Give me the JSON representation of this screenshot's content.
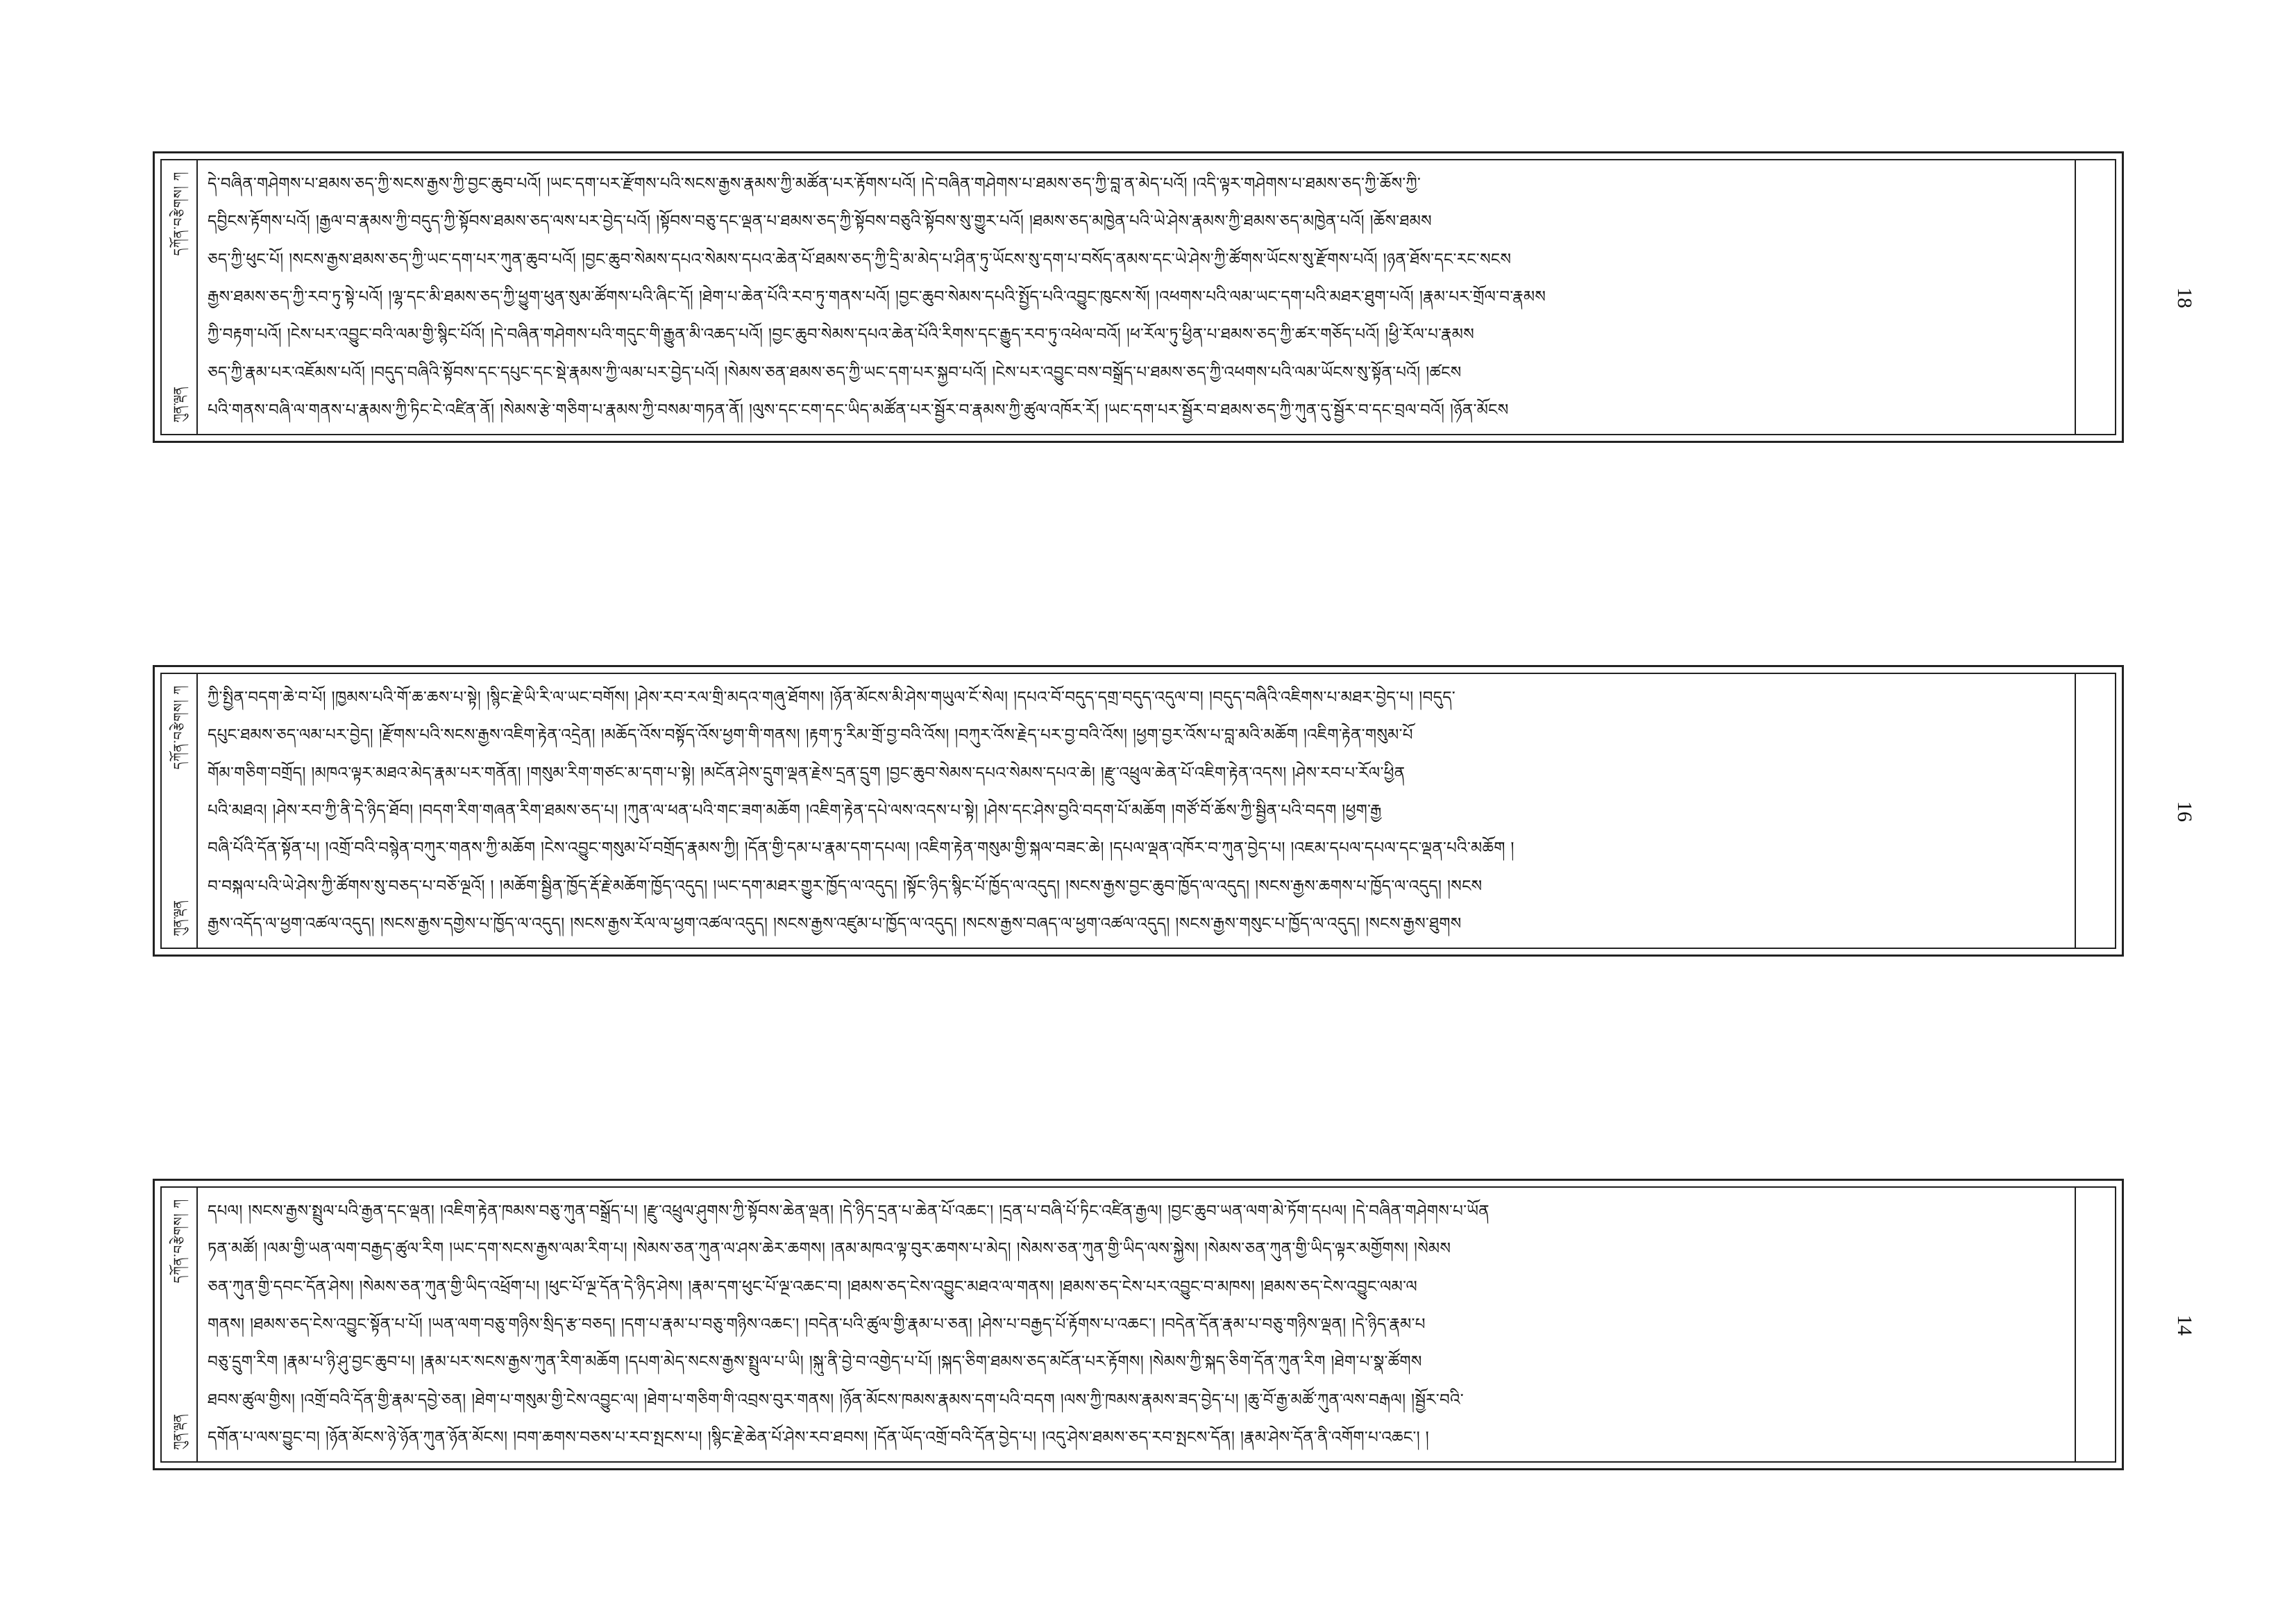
{
  "folios": [
    {
      "margin_title": "དཀོན་བརྩེགས། ཀ",
      "margin_mark": "ཀུན་ལྡན",
      "page_number": "18",
      "lines": [
        "དེ་བཞིན་གཤེགས་པ་ཐམས་ཅད་ཀྱི་སངས་རྒྱས་ཀྱི་བྱང་ཆུབ་པའོ། །ཡང་དག་པར་རྫོགས་པའི་སངས་རྒྱས་རྣམས་ཀྱི་མཚོན་པར་རྟོགས་པའོ། །དེ་བཞིན་གཤེགས་པ་ཐམས་ཅད་ཀྱི་བླ་ན་མེད་པའོ། །འདི་ལྟར་གཤེགས་པ་ཐམས་ཅད་ཀྱི་ཆོས་ཀྱི་",
        "དབྱིངས་རྟོགས་པའོ། །རྒྱལ་བ་རྣམས་ཀྱི་བདུད་ཀྱི་སྟོབས་ཐམས་ཅད་ལས་པར་བྱེད་པའོ། །སྟོབས་བཅུ་དང་ལྡན་པ་ཐམས་ཅད་ཀྱི་སྟོབས་བཅུའི་སྟོབས་སུ་གྱུར་པའོ། །ཐམས་ཅད་མཁྱེན་པའི་ཡེ་ཤེས་རྣམས་ཀྱི་ཐམས་ཅད་མཁྱེན་པའོ། །ཆོས་ཐམས",
        "ཅད་ཀྱི་ཕུང་པོ། །སངས་རྒྱས་ཐམས་ཅད་ཀྱི་ཡང་དག་པར་ཀུན་ཆུབ་པའོ། །བྱང་ཆུབ་སེམས་དཔའ་སེམས་དཔའ་ཆེན་པོ་ཐམས་ཅད་ཀྱི་དྲི་མ་མེད་པ་ཤིན་ཏུ་ཡོངས་སུ་དག་པ་བསོད་ནམས་དང་ཡེ་ཤེས་ཀྱི་ཚོགས་ཡོངས་སུ་རྫོགས་པའོ། །ཉན་ཐོས་དང་རང་སངས",
        "རྒྱས་ཐམས་ཅད་ཀྱི་རབ་ཏུ་སྟེ་པའོ། །ལྷ་དང་མི་ཐམས་ཅད་ཀྱི་ཕྱུག་ཕུན་སུམ་ཚོགས་པའི་ཞིང་དོ། །ཐེག་པ་ཆེན་པོའི་རབ་ཏུ་གནས་པའོ། །བྱང་ཆུབ་སེམས་དཔའི་སྤྱོད་པའི་འབྱུང་ཁུངས་སོ། །འཕགས་པའི་ལམ་ཡང་དག་པའི་མཐར་ཐུག་པའོ། །རྣམ་པར་གྲོལ་བ་རྣམས",
        "ཀྱི་བརྟག་པའོ། །ངེས་པར་འབྱུང་བའི་ལམ་གྱི་སྙིང་པོའོ། །དེ་བཞིན་གཤེགས་པའི་གདུང་གི་རྒྱུན་མི་འཆད་པའོ། །བྱང་ཆུབ་སེམས་དཔའ་ཆེན་པོའི་རིགས་དང་རྒྱུད་རབ་ཏུ་འཕེལ་བའོ། །ཕ་རོལ་ཏུ་ཕྱིན་པ་ཐམས་ཅད་ཀྱི་ཚར་གཅོད་པའོ། །ཕྱི་རོལ་པ་རྣམས",
        "ཅད་ཀྱི་རྣམ་པར་འཇོམས་པའོ། །བདུད་བཞིའི་སྟོབས་དང་དཔུང་དང་སྡེ་རྣམས་ཀྱི་ལམ་པར་བྱེད་པའོ། །སེམས་ཅན་ཐམས་ཅད་ཀྱི་ཡང་དག་པར་སྐྱབ་པའོ། །ངེས་པར་འབྱུང་བས་བསྒྲོད་པ་ཐམས་ཅད་ཀྱི་འཕགས་པའི་ལམ་ཡོངས་སུ་སྟོན་པའོ། །ཚངས",
        "པའི་གནས་བཞི་ལ་གནས་པ་རྣམས་ཀྱི་ཏིང་ངེ་འཛིན་ནོ། །སེམས་རྩེ་གཅིག་པ་རྣམས་ཀྱི་བསམ་གཏན་ནོ། །ལུས་དང་ངག་དང་ཡིད་མཚོན་པར་སྦྱོར་བ་རྣམས་ཀྱི་ཚུལ་འཁོར་རོ། །ཡང་དག་པར་སྦྱོར་བ་ཐམས་ཅད་ཀྱི་ཀུན་དུ་སྦྱོར་བ་དང་བྲལ་བའོ། །ཉོན་མོངས"
      ]
    },
    {
      "margin_title": "དཀོན་བརྩེགས། ཀ",
      "margin_mark": "ཀུན་ལྡན",
      "page_number": "16",
      "lines": [
        "ཀྱི་སྤྱིན་བདག་ཆེ་བ་པོ། །ཁྱམས་པའི་གོ་ཆ་ཆས་པ་སྟེ། །སྙིང་རྗེ་ཡི་རི་ལ་ཡང་བགོས། །ཤེས་རབ་རལ་གྲི་མདའ་གཞུ་ཐོགས། །ཉོན་མོངས་མི་ཤེས་གཡུལ་ངོ་སེལ། །དཔའ་བོ་བདུད་དགྲ་བདུད་འདུལ་བ། །བདུད་བཞིའི་འཇིགས་པ་མཐར་བྱེད་པ། །བདུད་",
        "དཔུང་ཐམས་ཅད་ལམ་པར་བྱེད། །རྫོགས་པའི་སངས་རྒྱས་འཇིག་རྟེན་འདྲེན། །མཆོད་འོས་བསྟོད་འོས་ཕྱག་གི་གནས། །རྟག་ཏུ་རིམ་གྲོ་བྱ་བའི་འོས། །བཀུར་འོས་རྗེད་པར་བྱ་བའི་འོས། །ཕྱག་བྱར་འོས་པ་བླ་མའི་མཆོག །འཇིག་རྟེན་གསུམ་པོ",
        "གོམ་གཅིག་བགྲོད། །མཁའ་ལྟར་མཐའ་མེད་རྣམ་པར་གནོན། །གསུམ་རིག་གཙང་མ་དག་པ་སྟེ། །མངོན་ཤེས་དྲུག་ལྡན་རྗེས་དྲན་དྲུག །བྱང་ཆུབ་སེམས་དཔའ་སེམས་དཔའ་ཆེ། །རྫུ་འཕྲུལ་ཆེན་པོ་འཇིག་རྟེན་འདས། །ཤེས་རབ་པ་རོལ་ཕྱིན",
        "པའི་མཐའ། །ཤེས་རབ་ཀྱི་ནི་དེ་ཉིད་ཐོབ། །བདག་རིག་གཞན་རིག་ཐམས་ཅད་པ། །ཀུན་ལ་ཕན་པའི་གང་ཟག་མཆོག །འཇིག་རྟེན་དཔེ་ལས་འདས་པ་སྟེ། །ཤེས་དང་ཤེས་བྱའི་བདག་པོ་མཆོག །གཙོ་བོ་ཆོས་ཀྱི་སྦྱིན་པའི་བདག །ཕྱག་རྒྱ",
        "བཞི་པོའི་དོན་སྟོན་པ། །འགྲོ་བའི་བསྙེན་བཀུར་གནས་ཀྱི་མཆོག །ངེས་འབྱུང་གསུམ་པོ་བགྲོད་རྣམས་ཀྱི། །དོན་གྱི་དམ་པ་རྣམ་དག་དཔལ། །འཇིག་རྟེན་གསུམ་གྱི་སྐལ་བཟང་ཆེ། །དཔལ་ལྡན་འཁོར་བ་ཀུན་བྱེད་པ། །འཇམ་དཔལ་དཔལ་དང་ལྡན་པའི་མཆོག །",
        "བ་བསྐལ་པའི་ཡེ་ཤེས་ཀྱི་ཚོགས་སུ་བཅད་པ་བཅོ་ལྔའོ། ། །མཆོག་སྦྱིན་ཁྱོད་རྡོ་རྗེ་མཆོག་ཁྱོད་འདུད། །ཡང་དག་མཐར་གྱུར་ཁྱོད་ལ་འདུད། །སྟོང་ཉིད་སྙིང་པོ་ཁྱོད་ལ་འདུད། །སངས་རྒྱས་བྱང་ཆུབ་ཁྱོད་ལ་འདུད། །སངས་རྒྱས་ཆགས་པ་ཁྱོད་ལ་འདུད། །སངས",
        "རྒྱས་འདོད་ལ་ཕྱག་འཚལ་འདུད། །སངས་རྒྱས་དགྱེས་པ་ཁྱོད་ལ་འདུད། །སངས་རྒྱས་རོལ་ལ་ཕྱག་འཚལ་འདུད། །སངས་རྒྱས་འཛུམ་པ་ཁྱོད་ལ་འདུད། །སངས་རྒྱས་བཞད་ལ་ཕྱག་འཚལ་འདུད། །སངས་རྒྱས་གསུང་པ་ཁྱོད་ལ་འདུད། །སངས་རྒྱས་ཐུགས"
      ]
    },
    {
      "margin_title": "དཀོན་བརྩེགས། ཀ",
      "margin_mark": "ཀུན་ལྡན",
      "page_number": "14",
      "lines": [
        "དཔལ། །སངས་རྒྱས་སྤྲུལ་པའི་རྒྱན་དང་ལྡན། །འཇིག་རྟེན་ཁམས་བཅུ་ཀུན་བསྒྲོད་པ། །རྫུ་འཕྲུལ་ཤུགས་ཀྱི་སྟོབས་ཆེན་ལྡན། །དེ་ཉིད་དྲན་པ་ཆེན་པོ་འཆང་། །དྲན་པ་བཞི་པོ་ཏིང་འཛིན་རྒྱལ། །བྱང་ཆུབ་ཡན་ལག་མེ་ཏོག་དཔལ། །དེ་བཞིན་གཤེགས་པ་ཡོན",
        "ཏན་མཚོ། །ལམ་གྱི་ཡན་ལག་བརྒྱད་ཚུལ་རིག །ཡང་དག་སངས་རྒྱས་ལམ་རིག་པ། །སེམས་ཅན་ཀུན་ལ་ཤས་ཆེར་ཆགས། །ནམ་མཁའ་ལྟ་བུར་ཆགས་པ་མེད། །སེམས་ཅན་ཀུན་གྱི་ཡིད་ལས་སྐྱེས། །སེམས་ཅན་ཀུན་གྱི་ཡིད་ལྟར་མགྱོགས། །སེམས",
        "ཅན་ཀུན་གྱི་དབང་དོན་ཤེས། །སེམས་ཅན་ཀུན་གྱི་ཡིད་འཕྲོག་པ། །ཕུང་པོ་ལྔ་དོན་དེ་ཉིད་ཤེས། །རྣམ་དག་ཕུང་པོ་ལྔ་འཆང་བ། །ཐམས་ཅད་ངེས་འབྱུང་མཐའ་ལ་གནས། །ཐམས་ཅད་ངེས་པར་འབྱུང་བ་མཁས། །ཐམས་ཅད་ངེས་འབྱུང་ལམ་ལ",
        "གནས། །ཐམས་ཅད་ངེས་འབྱུང་སྟོན་པ་པོ། །ཡན་ལག་བཅུ་གཉིས་སྲིད་རྩ་བཅད། །དག་པ་རྣམ་པ་བཅུ་གཉིས་འཆང་། །བདེན་པའི་ཚུལ་གྱི་རྣམ་པ་ཅན། །ཤེས་པ་བརྒྱད་པོ་རྟོགས་པ་འཆང་། །བདེན་དོན་རྣམ་པ་བཅུ་གཉིས་ལྡན། །དེ་ཉིད་རྣམ་པ",
        "བཅུ་དྲུག་རིག །རྣམ་པ་ཉི་ཤུ་བྱང་ཆུབ་པ། །རྣམ་པར་སངས་རྒྱས་ཀུན་རིག་མཆོག །དཔག་མེད་སངས་རྒྱས་སྤྲུལ་པ་ཡི། །སྐུ་ནི་བྱེ་བ་འགྱེད་པ་པོ། །སྐད་ཅིག་ཐམས་ཅད་མངོན་པར་རྟོགས། །སེམས་ཀྱི་སྐད་ཅིག་དོན་ཀུན་རིག །ཐེག་པ་སྣ་ཚོགས",
        "ཐབས་ཚུལ་གྱིས། །འགྲོ་བའི་དོན་གྱི་རྣམ་དབྱེ་ཅན། །ཐེག་པ་གསུམ་གྱི་ངེས་འབྱུང་ལ། །ཐེག་པ་གཅིག་གི་འབྲས་བུར་གནས། །ཉོན་མོངས་ཁམས་རྣམས་དག་པའི་བདག །ལས་ཀྱི་ཁམས་རྣམས་ཟད་བྱེད་པ། །ཆུ་བོ་རྒྱ་མཚོ་ཀུན་ལས་བརྒལ། །སྦྱོར་བའི་",
        "དགོན་པ་ལས་བྱུང་བ། །ཉོན་མོངས་ཉེ་ཉོན་ཀུན་ཉོན་མོངས། །བག་ཆགས་བཅས་པ་རབ་སྤངས་པ། །སྙིང་རྗེ་ཆེན་པོ་ཤེས་རབ་ཐབས། །དོན་ཡོད་འགྲོ་བའི་དོན་བྱེད་པ། །འདུ་ཤེས་ཐམས་ཅད་རབ་སྤངས་དོན། །རྣམ་ཤེས་དོན་ནི་འགོག་པ་འཆང་། །"
      ]
    }
  ]
}
